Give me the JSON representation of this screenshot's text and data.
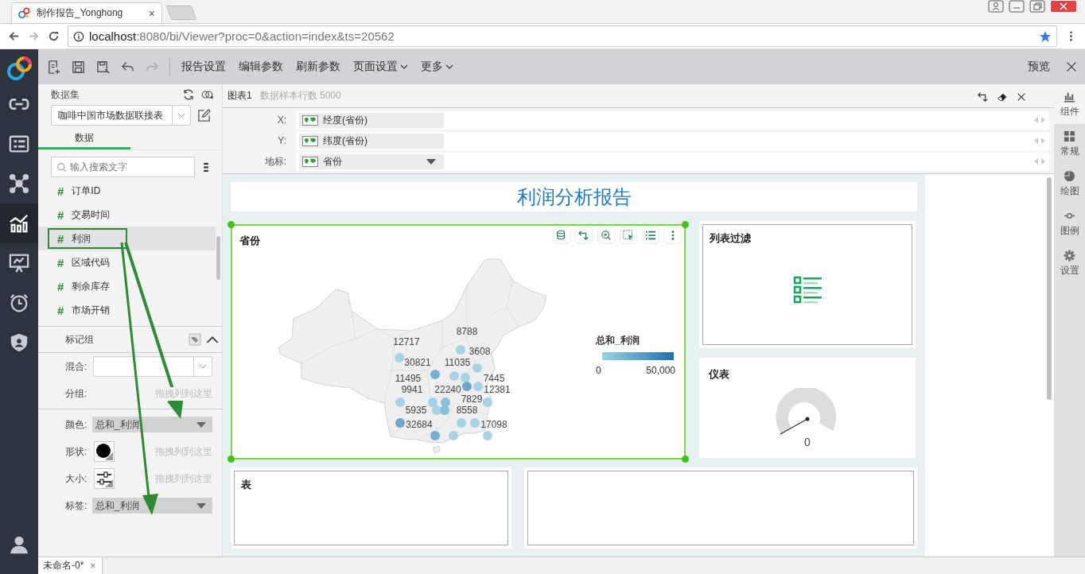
{
  "browser": {
    "tab_title": "制作报告_Yonghong",
    "tab_close": "×",
    "url_host": "localhost",
    "url_rest": ":8080/bi/Viewer?proc=0&action=index&ts=20562"
  },
  "nav": [
    {
      "kind": "link",
      "selected": false
    },
    {
      "kind": "list",
      "selected": false
    },
    {
      "kind": "network",
      "selected": false
    },
    {
      "kind": "chart",
      "selected": true
    },
    {
      "kind": "presentation",
      "selected": false
    },
    {
      "kind": "alarm",
      "selected": false
    },
    {
      "kind": "shield",
      "selected": false
    }
  ],
  "toolbar": {
    "tools": [
      {
        "kind": "new",
        "disabled": false
      },
      {
        "kind": "save",
        "disabled": false
      },
      {
        "kind": "save-as",
        "disabled": false
      },
      {
        "kind": "undo",
        "disabled": false
      },
      {
        "kind": "redo",
        "disabled": true
      }
    ],
    "menus": [
      {
        "label": "报告设置",
        "dropdown": false
      },
      {
        "label": "编辑参数",
        "dropdown": false
      },
      {
        "label": "刷新参数",
        "dropdown": false
      },
      {
        "label": "页面设置",
        "dropdown": true
      },
      {
        "label": "更多",
        "dropdown": true
      }
    ],
    "preview": "预览"
  },
  "left_panel": {
    "dataset_label": "数据集",
    "dataset": "咖啡中国市场数据联接表",
    "tab": "数据",
    "search_placeholder": "输入搜索文字",
    "fields": [
      {
        "type_mark": "#",
        "name": "订单ID",
        "selected": false
      },
      {
        "type_mark": "#",
        "name": "交易时间",
        "selected": false
      },
      {
        "type_mark": "#",
        "name": "利润",
        "selected": true
      },
      {
        "type_mark": "#",
        "name": "区域代码",
        "selected": false
      },
      {
        "type_mark": "#",
        "name": "剩余库存",
        "selected": false
      },
      {
        "type_mark": "#",
        "name": "市场开销",
        "selected": false
      }
    ],
    "mark_group": {
      "title": "标记组",
      "blend_label": "混合:",
      "group_label": "分组:",
      "group_placeholder": "拖拽列到这里",
      "bindings": [
        {
          "label": "颜色:",
          "kind": "dropdown",
          "value": "总和_利润"
        },
        {
          "label": "形状:",
          "kind": "shape",
          "placeholder": "拖拽列到这里"
        },
        {
          "label": "大小:",
          "kind": "size",
          "placeholder": "拖拽列到这里"
        },
        {
          "label": "标签:",
          "kind": "dropdown",
          "value": "总和_利润"
        }
      ]
    }
  },
  "chart_editor": {
    "title": "图表1",
    "sample": "数据样本行数 5000",
    "bindings": [
      {
        "label": "X:",
        "field": "经度(省份)",
        "dropdown": false
      },
      {
        "label": "Y:",
        "field": "纬度(省份)",
        "dropdown": false
      },
      {
        "label": "地标:",
        "field": "省份",
        "dropdown": true
      }
    ]
  },
  "report": {
    "title": "利润分析报告",
    "map_card": {
      "title": "省份",
      "selected": true,
      "legend": {
        "title": "总和_利润",
        "min": "0",
        "max": "50,000"
      },
      "bubbles": [
        {
          "color": "#a6d3e3"
        },
        {
          "color": "#a6d3e3"
        },
        {
          "color": "#a6d3e3"
        },
        {
          "color": "#74aed0"
        },
        {
          "color": "#a6d3e3"
        },
        {
          "color": "#a6d3e3"
        },
        {
          "color": "#6aa6cd"
        },
        {
          "color": "#a6d3e3"
        },
        {
          "color": "#a6d3e3"
        },
        {
          "color": "#a6d3e3"
        },
        {
          "color": "#8bbfd8"
        },
        {
          "color": "#a6d3e3"
        },
        {
          "color": "#a6d3e3"
        },
        {
          "color": "#8bbfd8"
        },
        {
          "color": "#6ea8cd"
        },
        {
          "color": "#a6d3e3"
        },
        {
          "color": "#a6d3e3"
        },
        {
          "color": "#74aed0"
        },
        {
          "color": "#a6d3e3"
        },
        {
          "color": "#a6d3e3"
        }
      ],
      "bubble_labels": [
        "8788",
        "12717",
        "3608",
        "30821",
        "11035",
        "11495",
        "7445",
        "9941",
        "22240",
        "12381",
        "7829",
        "5935",
        "8558",
        "32684",
        "17098"
      ]
    },
    "filter_card": {
      "title": "列表过滤"
    },
    "gauge_card": {
      "title": "仪表",
      "value": "0"
    },
    "table_card": {
      "title": "表"
    }
  },
  "right_sidebar": [
    {
      "label": "组件",
      "kind": "components",
      "selected": true
    },
    {
      "label": "常规",
      "kind": "general",
      "selected": false
    },
    {
      "label": "绘图",
      "kind": "plot",
      "selected": false
    },
    {
      "label": "图例",
      "kind": "legend",
      "selected": false
    },
    {
      "label": "设置",
      "kind": "settings",
      "selected": false
    }
  ],
  "bottom_tabs": [
    {
      "label": "未命名-0*",
      "close": "×",
      "selected": true
    }
  ]
}
